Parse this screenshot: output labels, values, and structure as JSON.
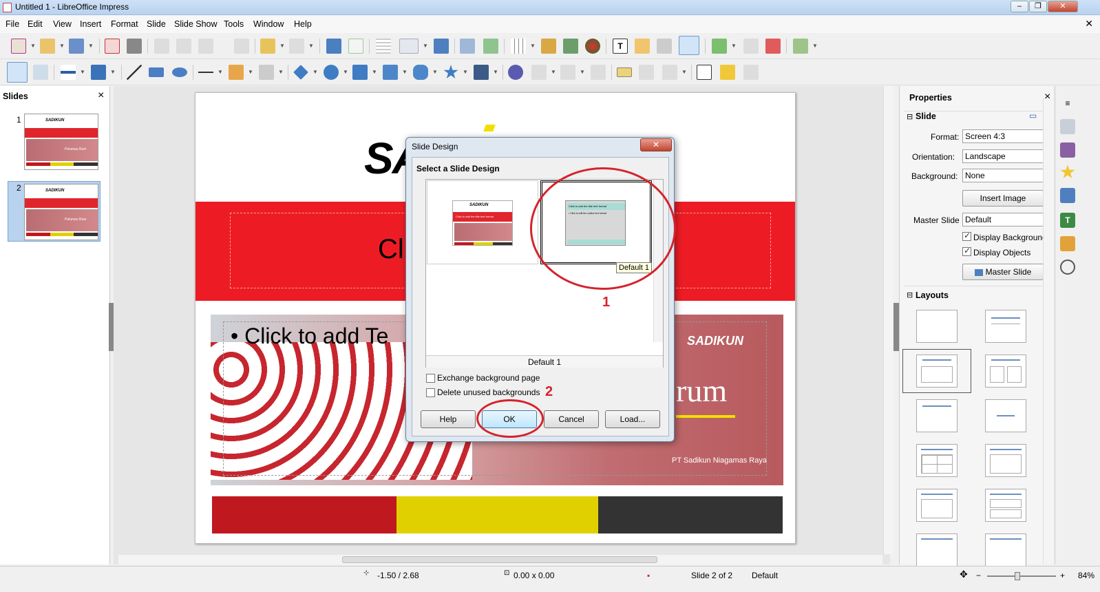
{
  "window": {
    "title": "Untitled 1 - LibreOffice Impress"
  },
  "menu": [
    "File",
    "Edit",
    "View",
    "Insert",
    "Format",
    "Slide",
    "Slide Show",
    "Tools",
    "Window",
    "Help"
  ],
  "slides_pane": {
    "title": "Slides",
    "close": "×",
    "thumb_logo": "SADIKUN",
    "thumb_text": "Pelumas Rum",
    "numbers": [
      "1",
      "2"
    ]
  },
  "slide": {
    "logo": "SADIKUN",
    "title_placeholder": "Cl",
    "content_placeholder": "Click to add Te",
    "right_logo": "SADIKUN",
    "right_big_text": "rum",
    "right_footer": "PT Sadikun Niagamas Raya",
    "bar_colors": [
      "#c0181f",
      "#e1d000",
      "#333333"
    ]
  },
  "dialog": {
    "title": "Slide Design",
    "close": "✕",
    "section_label": "Select a Slide Design",
    "design1_caption": "Click to add the title text format",
    "design2_caption": "Click to add the title text format",
    "design2_sub": "• Click to edit the outline text format",
    "tooltip": "Default 1",
    "selected_name": "Default 1",
    "exchange_bg": "Exchange background page",
    "delete_unused": "Delete unused backgrounds",
    "buttons": {
      "help": "Help",
      "ok": "OK",
      "cancel": "Cancel",
      "load": "Load..."
    },
    "annotation_1": "1",
    "annotation_2": "2"
  },
  "properties": {
    "title": "Properties",
    "close": "×",
    "slide_section": "Slide",
    "format_label": "Format:",
    "format_value": "Screen 4:3",
    "orientation_label": "Orientation:",
    "orientation_value": "Landscape",
    "background_label": "Background:",
    "background_value": "None",
    "insert_image": "Insert Image",
    "master_slide_label": "Master Slide",
    "master_slide_value": "Default",
    "display_background": "Display Background",
    "display_objects": "Display Objects",
    "master_slide_btn": "Master Slide",
    "layouts_section": "Layouts"
  },
  "status": {
    "position": "-1.50 / 2.68",
    "size": "0.00 x 0.00",
    "slide_count": "Slide 2 of 2",
    "master": "Default",
    "zoom": "84%"
  }
}
